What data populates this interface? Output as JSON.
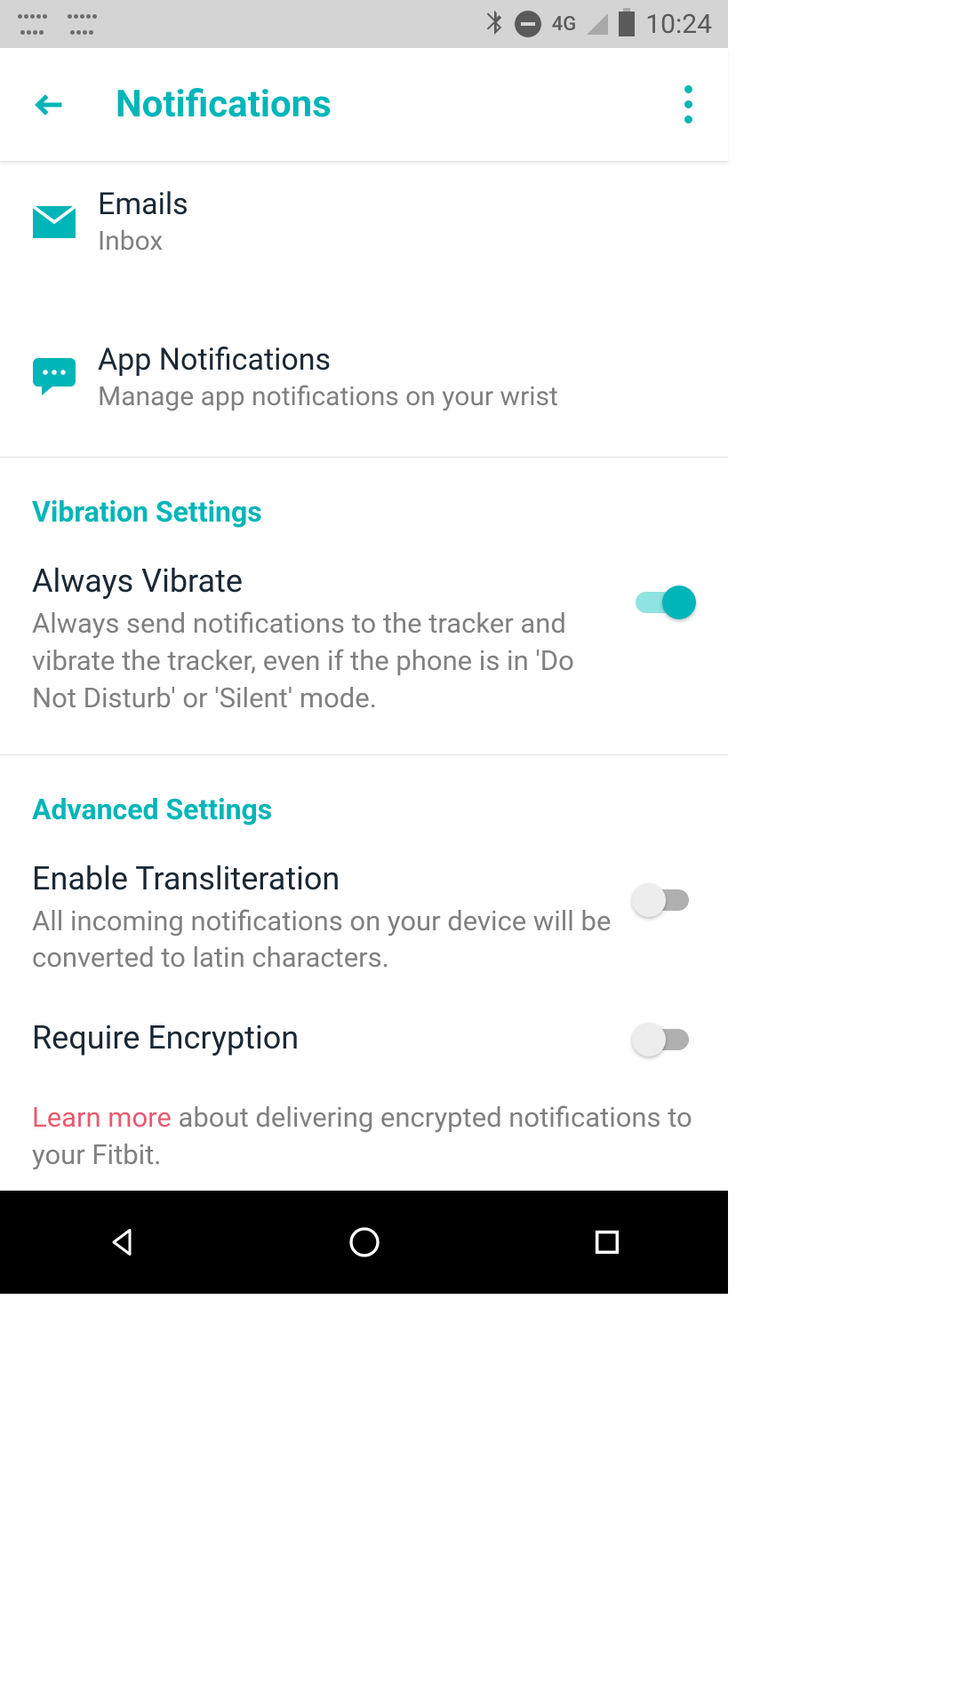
{
  "statusbar": {
    "network": "4G",
    "time": "10:24"
  },
  "appbar": {
    "title": "Notifications"
  },
  "items": {
    "emails": {
      "title": "Emails",
      "sub": "Inbox"
    },
    "appnotif": {
      "title": "App Notifications",
      "sub": "Manage app notifications on your wrist"
    }
  },
  "sections": {
    "vibration": {
      "header": "Vibration Settings",
      "always_vibrate": {
        "title": "Always Vibrate",
        "desc": "Always send notifications to the tracker and vibrate the tracker, even if the phone is in 'Do Not Disturb' or 'Silent' mode.",
        "on": true
      }
    },
    "advanced": {
      "header": "Advanced Settings",
      "transliteration": {
        "title": "Enable Transliteration",
        "desc": "All incoming notifications on your device will be converted to latin characters.",
        "on": false
      },
      "encryption": {
        "title": "Require Encryption",
        "on": false
      },
      "footer": {
        "link": "Learn more",
        "rest": " about delivering encrypted notifications to your Fitbit."
      }
    }
  }
}
